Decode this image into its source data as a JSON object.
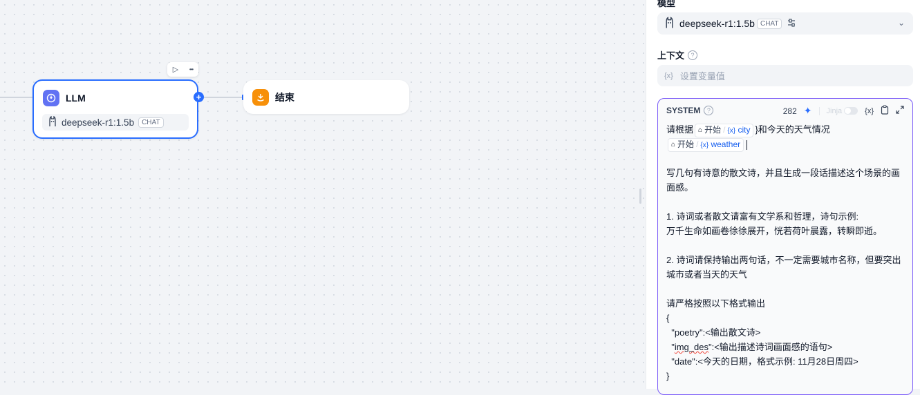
{
  "canvas": {
    "llm_node": {
      "title": "LLM",
      "model_name": "deepseek-r1:1.5b",
      "model_tag": "CHAT"
    },
    "end_node": {
      "title": "结束"
    },
    "toolbar": {
      "run_icon": "▷",
      "more_icon": "•••"
    }
  },
  "panel": {
    "model_label": "模型",
    "model": {
      "name": "deepseek-r1:1.5b",
      "tag": "CHAT"
    },
    "context_label": "上下文",
    "context_placeholder": "设置变量值",
    "var_symbol": "{x}",
    "prompt": {
      "role": "SYSTEM",
      "token_count": "282",
      "jinja_label": "Jinja",
      "lines": {
        "l1_prefix": "请根据",
        "chip1_node": "开始",
        "chip1_var": "city",
        "l1_suffix": "}和今天的天气情况",
        "chip2_node": "开始",
        "chip2_var": "weather",
        "p1": "写几句有诗意的散文诗，并且生成一段话描述这个场景的画面感。",
        "p2a": "1. 诗词或者散文请富有文学系和哲理，诗句示例:",
        "p2b": "万千生命如画卷徐徐展开，恍若荷叶晨露，转瞬即逝。",
        "p3": "2. 诗词请保持输出两句话，不一定需要城市名称，但要突出城市或者当天的天气",
        "p4": "请严格按照以下格式输出",
        "brace_open": "{",
        "j1": "  \"poetry\":<输出散文诗>",
        "j2_pre": "  \"",
        "j2_key": "img_des",
        "j2_post": "\":<输出描述诗词画面感的语句>",
        "j3": "  \"date\":<今天的日期，格式示例: 11月28日周四>",
        "brace_close": "}"
      }
    }
  },
  "colors": {
    "accent": "#296dff",
    "llm_icon": "#6172f3",
    "end_icon": "#f79009",
    "prompt_border": "#7a5af8"
  }
}
